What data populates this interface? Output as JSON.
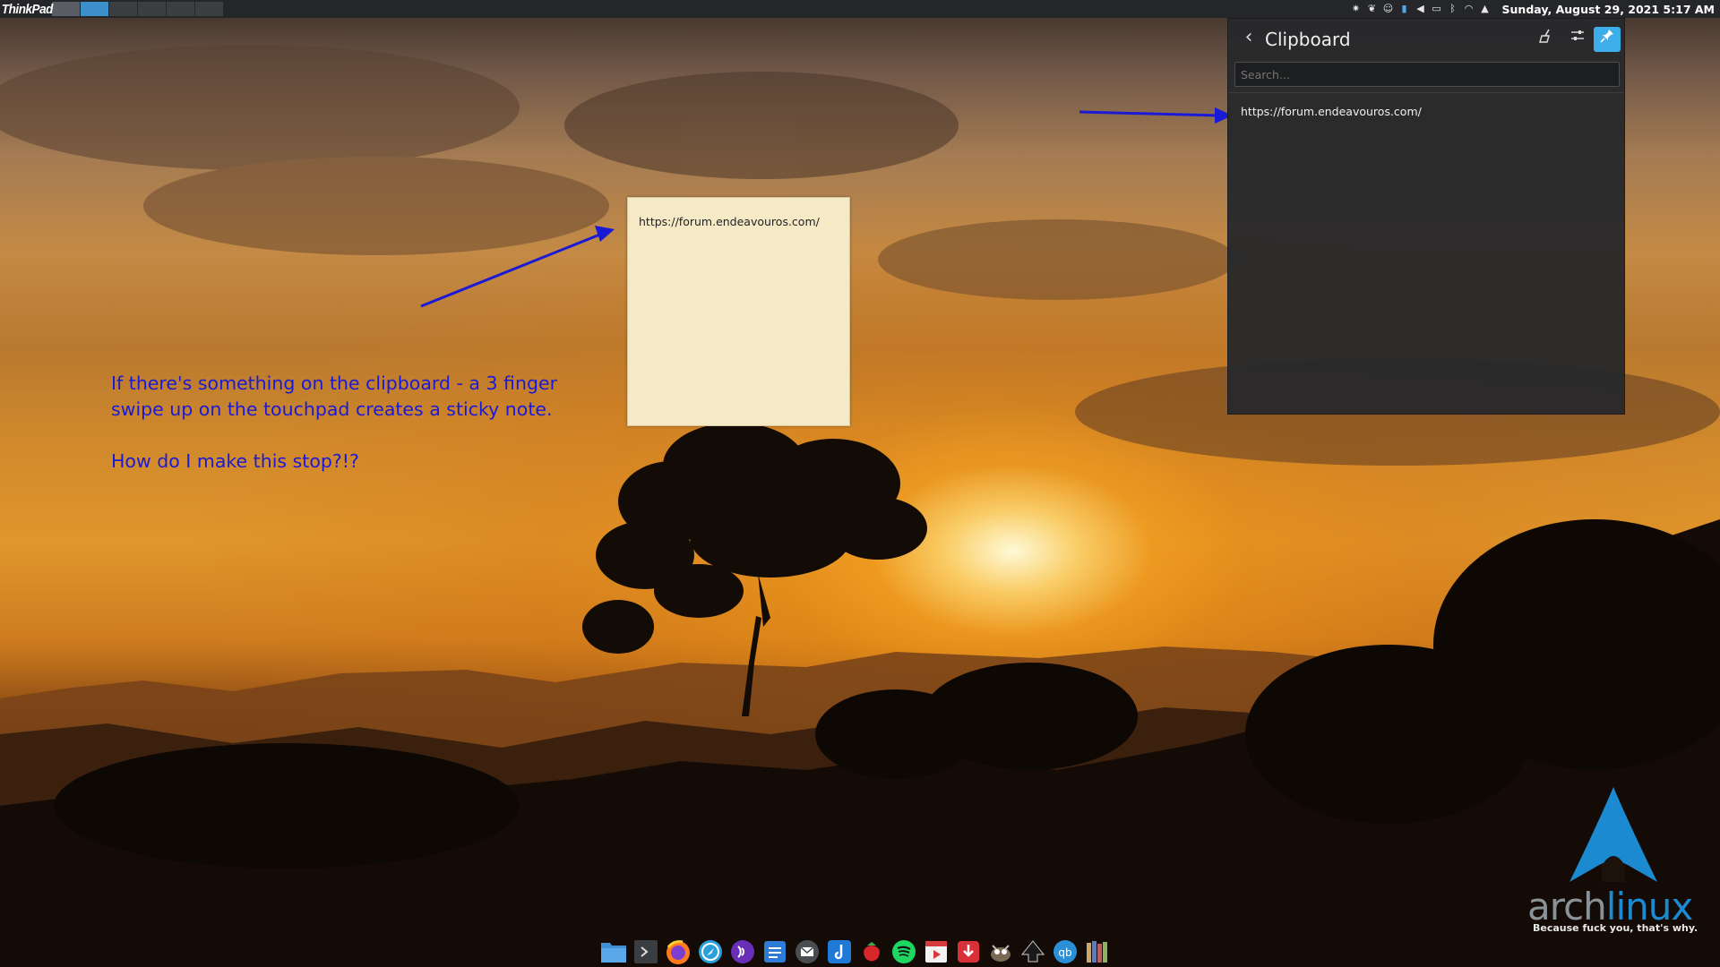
{
  "top_panel": {
    "logo_text": "ThinkPad",
    "virtual_desktops": [
      "Desktop 1",
      "Desktop 2",
      "Desktop 3",
      "Desktop 4",
      "Desktop 5",
      "Desktop 6"
    ],
    "active_desktop_index": 1,
    "tray_icons": [
      "settings-gear-icon",
      "plant-icon",
      "user-icon",
      "battery-icon",
      "volume-icon",
      "display-icon",
      "bluetooth-icon",
      "wifi-icon",
      "expand-arrow-icon"
    ],
    "clock_text": "Sunday, August 29, 2021   5:17 AM"
  },
  "annotation": {
    "line1": "If there's something on the clipboard - a 3 finger",
    "line2": "swipe up on the touchpad creates a sticky note.",
    "question": "How do I make this stop?!?"
  },
  "sticky_note": {
    "text": "https://forum.endeavouros.com/",
    "color": "#f6e9c6"
  },
  "clipboard": {
    "title": "Clipboard",
    "search_placeholder": "Search...",
    "items": [
      "https://forum.endeavouros.com/"
    ],
    "accent_color": "#3daee9"
  },
  "dock": {
    "apps": [
      "file-manager-icon",
      "terminal-icon",
      "firefox-icon",
      "browser-icon",
      "podcast-icon",
      "notes-icon",
      "mail-icon",
      "music-app-icon",
      "strawberry-icon",
      "spotify-icon",
      "video-editor-icon",
      "downloader-icon",
      "gimp-icon",
      "inkscape-icon",
      "qbittorrent-icon",
      "library-icon"
    ]
  },
  "arch_logo": {
    "word_grey": "arch",
    "word_blue": "linux",
    "tagline": "Because fuck you, that's why."
  },
  "annotation_color": "#1a1ad6"
}
